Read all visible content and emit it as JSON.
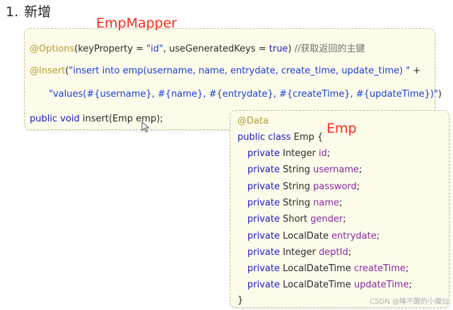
{
  "heading": {
    "number": "1.",
    "text": "新增"
  },
  "mapper": {
    "title": "EmpMapper",
    "line1": {
      "annotation": "@Options",
      "open": "(keyProperty = ",
      "key_value": "\"id\"",
      "mid": ", useGeneratedKeys = ",
      "bool_value": "true",
      "close": ")",
      "comment": "//获取返回的主键"
    },
    "line2": {
      "annotation": "@Insert",
      "open": "(",
      "sql": "\"insert into emp(username, name, entrydate, create_time, update_time) \"",
      "plus": " +"
    },
    "line3": {
      "sql": "\"values(#{username}, #{name}, #{entrydate}, #{createTime}, #{updateTime})\"",
      "close": ")"
    },
    "line4": {
      "kw": "public void",
      "sig": " insert(Emp emp);"
    }
  },
  "emp": {
    "title": "Emp",
    "annotation": "@Data",
    "class_decl": {
      "kw": "public class",
      "rest": " Emp {"
    },
    "fields": [
      {
        "mod": "private",
        "type": "Integer",
        "name": "id"
      },
      {
        "mod": "private",
        "type": "String",
        "name": "username"
      },
      {
        "mod": "private",
        "type": "String",
        "name": "password"
      },
      {
        "mod": "private",
        "type": "String",
        "name": "name"
      },
      {
        "mod": "private",
        "type": "Short",
        "name": "gender"
      },
      {
        "mod": "private",
        "type": "LocalDate",
        "name": "entrydate"
      },
      {
        "mod": "private",
        "type": "Integer",
        "name": "deptId"
      },
      {
        "mod": "private",
        "type": "LocalDateTime",
        "name": "createTime"
      },
      {
        "mod": "private",
        "type": "LocalDateTime",
        "name": "updateTime"
      }
    ],
    "close_brace": "}"
  },
  "watermark": "CSDN @睡不醒的小魔仙"
}
